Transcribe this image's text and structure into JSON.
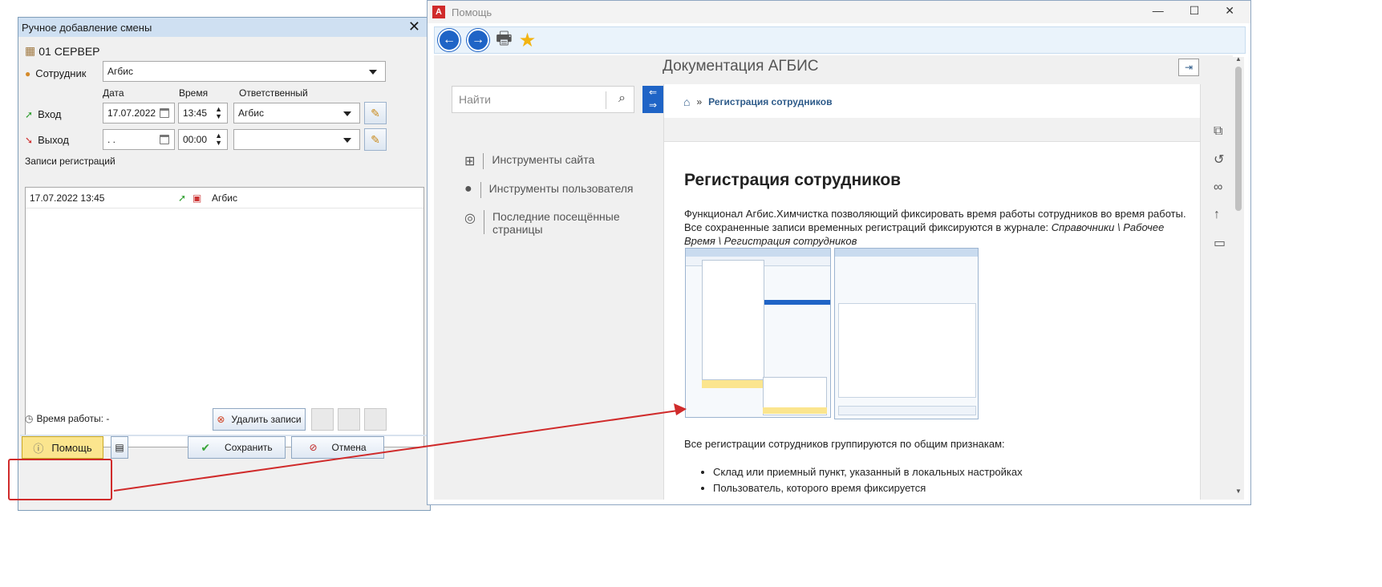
{
  "dialog": {
    "title": "Ручное добавление смены",
    "location": "01 СЕРВЕР",
    "employee_label": "Сотрудник",
    "employee_value": "Агбис",
    "col_date": "Дата",
    "col_time": "Время",
    "col_responsible": "Ответственный",
    "entry_label": "Вход",
    "entry_date": "17.07.2022",
    "entry_time": "13:45",
    "entry_responsible": "Агбис",
    "exit_label": "Выход",
    "exit_date": " .  .",
    "exit_time": "00:00",
    "exit_responsible": "",
    "records_label": "Записи регистраций",
    "records": [
      {
        "datetime": "17.07.2022 13:45",
        "name": "Агбис"
      }
    ],
    "work_time_label": "Время работы: -",
    "delete_button": "Удалить записи",
    "help_button": "Помощь",
    "save_button": "Сохранить",
    "cancel_button": "Отмена"
  },
  "help_window": {
    "title": "Помощь",
    "doc_title": "Документация АГБИС",
    "search_placeholder": "Найти",
    "side_links": [
      "Инструменты сайта",
      "Инструменты пользователя",
      "Последние посещённые страницы"
    ],
    "breadcrumb": "Регистрация сотрудников",
    "breadcrumb_sep": "»",
    "heading": "Регистрация сотрудников",
    "para_normal": "Функционал Агбис.Химчистка позволяющий фиксировать время работы сотрудников во время работы. Все сохраненные записи временных регистраций фиксируются в журнале: ",
    "para_italic": "Справочники \\ Рабочее Время \\ Регистрация сотрудников",
    "para2": "Все регистрации сотрудников группируются по общим признакам:",
    "bullets": [
      "Склад или приемный пункт, указанный в локальных настройках",
      "Пользователь, которого время фиксируется"
    ]
  },
  "colors": {
    "accent_blue": "#1f64c6",
    "highlight_yellow": "#fbe58e",
    "annotation_red": "#d02b2b"
  }
}
